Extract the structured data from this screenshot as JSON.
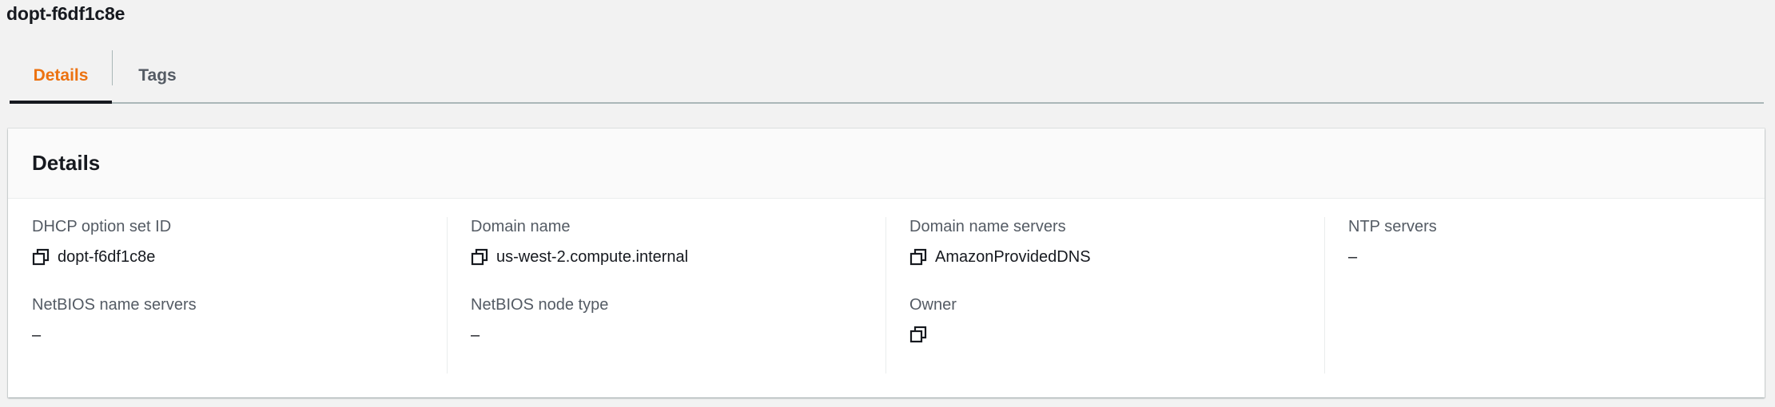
{
  "page": {
    "title": "dopt-f6df1c8e"
  },
  "tabs": [
    {
      "label": "Details",
      "active": true
    },
    {
      "label": "Tags",
      "active": false
    }
  ],
  "colors": {
    "active_tab": "#ec7211",
    "inactive_tab": "#545b64",
    "label": "#545b64",
    "text": "#16191f",
    "background": "#f2f2f2",
    "panel": "#ffffff"
  },
  "panel": {
    "title": "Details",
    "fields": [
      {
        "label": "DHCP option set ID",
        "value": "dopt-f6df1c8e",
        "copyable": true,
        "icon": "copy-icon"
      },
      {
        "label": "Domain name",
        "value": "us-west-2.compute.internal",
        "copyable": true,
        "icon": "copy-icon"
      },
      {
        "label": "Domain name servers",
        "value": "AmazonProvidedDNS",
        "copyable": true,
        "icon": "copy-icon"
      },
      {
        "label": "NTP servers",
        "value": "–",
        "copyable": false
      },
      {
        "label": "NetBIOS name servers",
        "value": "–",
        "copyable": false
      },
      {
        "label": "NetBIOS node type",
        "value": "–",
        "copyable": false
      },
      {
        "label": "Owner",
        "value": "",
        "copyable": true,
        "icon": "copy-icon"
      }
    ]
  }
}
